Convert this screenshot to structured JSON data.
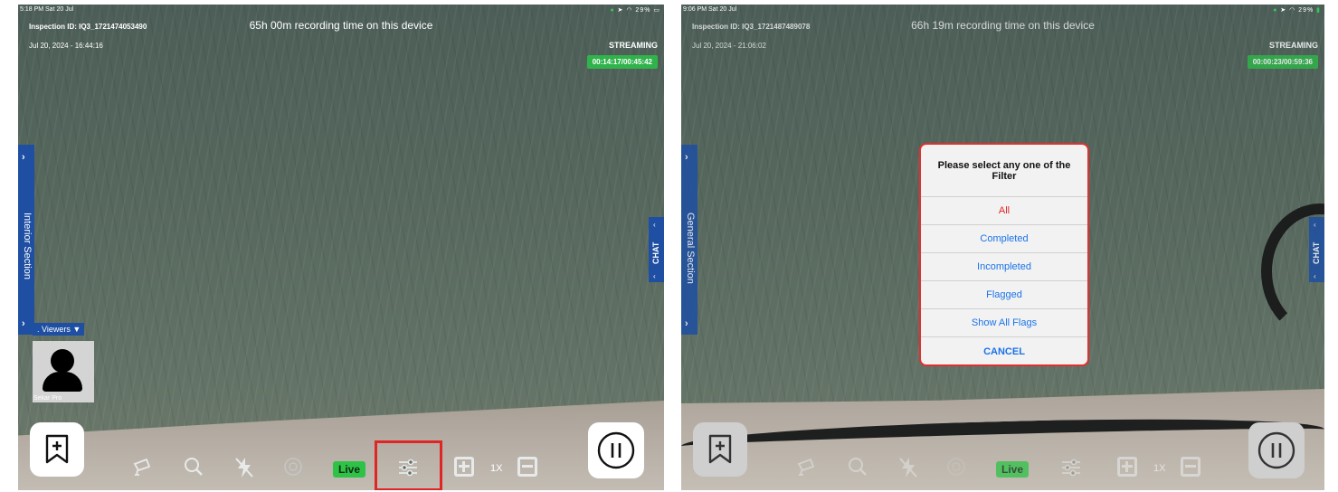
{
  "left": {
    "status": {
      "time": "5:18 PM  Sat 20 Jul",
      "battery": "29%"
    },
    "inspection_id": "Inspection ID: IQ3_1721474053490",
    "date": "Jul 20, 2024 - 16:44:16",
    "recording_time": "65h 00m recording time on this device",
    "streaming": "STREAMING",
    "timer": "00:14:17/00:45:42",
    "section_label": "Interior Section",
    "chat_label": "CHAT",
    "viewers_label": ". Viewers ▼",
    "viewer_name": "Sekar Pro",
    "live_label": "Live",
    "zoom": "1X"
  },
  "right": {
    "status": {
      "time": "9:06 PM  Sat 20 Jul",
      "battery": "29%"
    },
    "inspection_id": "Inspection ID: IQ3_1721487489078",
    "date": "Jul 20, 2024 - 21:06:02",
    "recording_time": "66h 19m recording time on this device",
    "streaming": "STREAMING",
    "timer": "00:00:23/00:59:36",
    "section_label": "General Section",
    "chat_label": "CHAT",
    "live_label": "Live",
    "zoom": "1X",
    "filter_dialog": {
      "title": "Please select any one of the Filter",
      "options": [
        "All",
        "Completed",
        "Incompleted",
        "Flagged",
        "Show All Flags"
      ],
      "selected": "All",
      "cancel": "CANCEL"
    }
  },
  "colors": {
    "accent_blue": "#1e4fa3",
    "streaming_green": "#2fb34a",
    "live_green": "#2ec246",
    "highlight_red": "#e02525"
  },
  "icons": [
    "bookmark-add-icon",
    "camera-icon",
    "search-icon",
    "flash-off-icon",
    "target-icon",
    "filter-sliders-icon",
    "zoom-in-icon",
    "zoom-out-icon",
    "pause-icon",
    "person-icon"
  ]
}
